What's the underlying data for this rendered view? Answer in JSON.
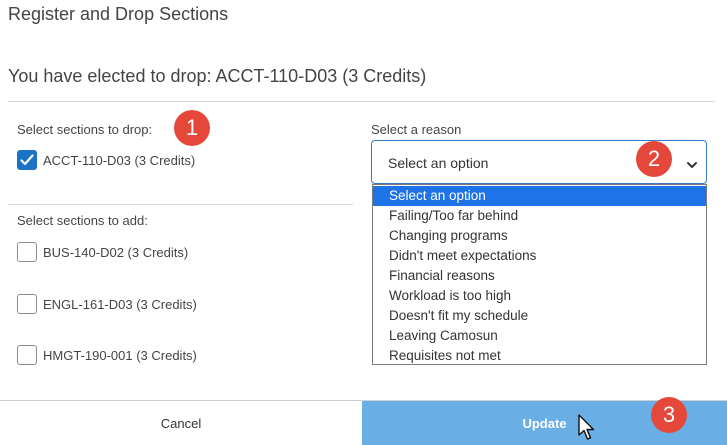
{
  "dialog": {
    "title": "Register and Drop Sections",
    "subtitle": "You have elected to drop: ACCT-110-D03 (3 Credits)"
  },
  "drop": {
    "label": "Select sections to drop:",
    "items": [
      {
        "label": "ACCT-110-D03 (3 Credits)",
        "checked": true
      }
    ]
  },
  "reason": {
    "label": "Select a reason",
    "selected": "Select an option",
    "options": [
      "Select an option",
      "Failing/Too far behind",
      "Changing programs",
      "Didn't meet expectations",
      "Financial reasons",
      "Workload is too high",
      "Doesn't fit my schedule",
      "Leaving Camosun",
      "Requisites not met"
    ]
  },
  "add": {
    "label": "Select sections to add:",
    "items": [
      {
        "label": "BUS-140-D02 (3 Credits)",
        "checked": false
      },
      {
        "label": "ENGL-161-D03 (3 Credits)",
        "checked": false
      },
      {
        "label": "HMGT-190-001 (3 Credits)",
        "checked": false
      }
    ]
  },
  "badges": [
    "1",
    "2",
    "3"
  ],
  "footer": {
    "cancel_label": "Cancel",
    "update_label": "Update"
  },
  "colors": {
    "accent": "#1a73c7",
    "badge": "#e5473a",
    "update_button": "#6aaee6",
    "option_highlight": "#1e73e8"
  }
}
